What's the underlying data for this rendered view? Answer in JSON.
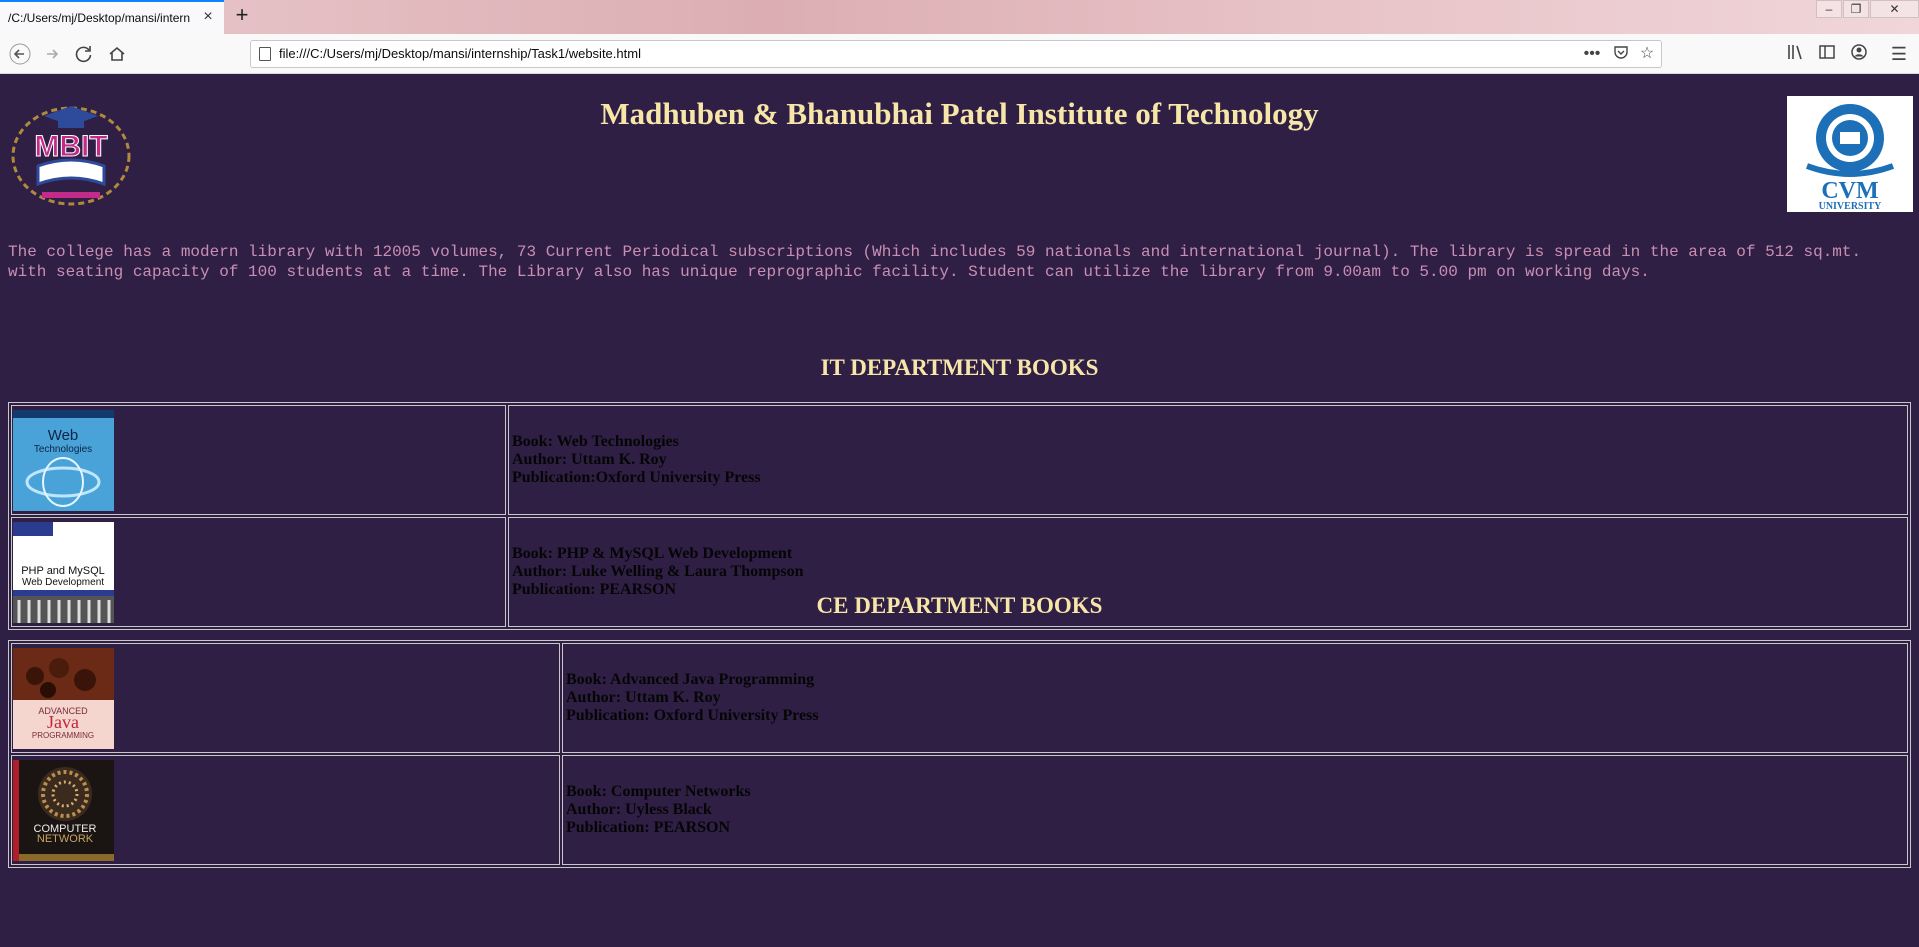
{
  "browser": {
    "tab_title": "/C:/Users/mj/Desktop/mansi/intern",
    "url": "file:///C:/Users/mj/Desktop/mansi/internship/Task1/website.html"
  },
  "page": {
    "title": "Madhuben & Bhanubhai Patel Institute of Technology",
    "intro_line1": "The college has a modern library with 12005 volumes, 73 Current Periodical subscriptions (Which includes 59 nationals and international journal). The library is spread in the area of 512 sq.mt.",
    "intro_line2": "with seating capacity of 100 students at a time. The Library also has unique reprographic facility. Student can utilize the library from 9.00am to 5.00 pm on working days.",
    "logos": {
      "left": "MBIT",
      "right": "CVM UNIVERSITY"
    },
    "colors": {
      "background": "#2f1f45",
      "heading": "#f7e6a8",
      "intro_text": "#c98fb2"
    }
  },
  "it_section": {
    "heading": "IT DEPARTMENT BOOKS",
    "books": [
      {
        "book": "Book: Web Technologies",
        "author": "Author: Uttam K. Roy",
        "publication": "Publication:Oxford University Press",
        "cover_title": "Web Technologies"
      },
      {
        "book": "Book: PHP & MySQL Web Development",
        "author": "Author: Luke Welling & Laura Thompson",
        "publication": "Publication: PEARSON",
        "cover_title": "PHP and MySQL Web Development"
      }
    ]
  },
  "ce_section": {
    "heading": "CE DEPARTMENT BOOKS",
    "books": [
      {
        "book": "Book: Advanced Java Programming",
        "author": "Author: Uttam K. Roy",
        "publication": "Publication: Oxford University Press",
        "cover_title": "ADVANCED Java PROGRAMMING"
      },
      {
        "book": "Book: Computer Networks",
        "author": "Author: Uyless Black",
        "publication": "Publication: PEARSON",
        "cover_title": "COMPUTER NETWORK"
      }
    ]
  }
}
